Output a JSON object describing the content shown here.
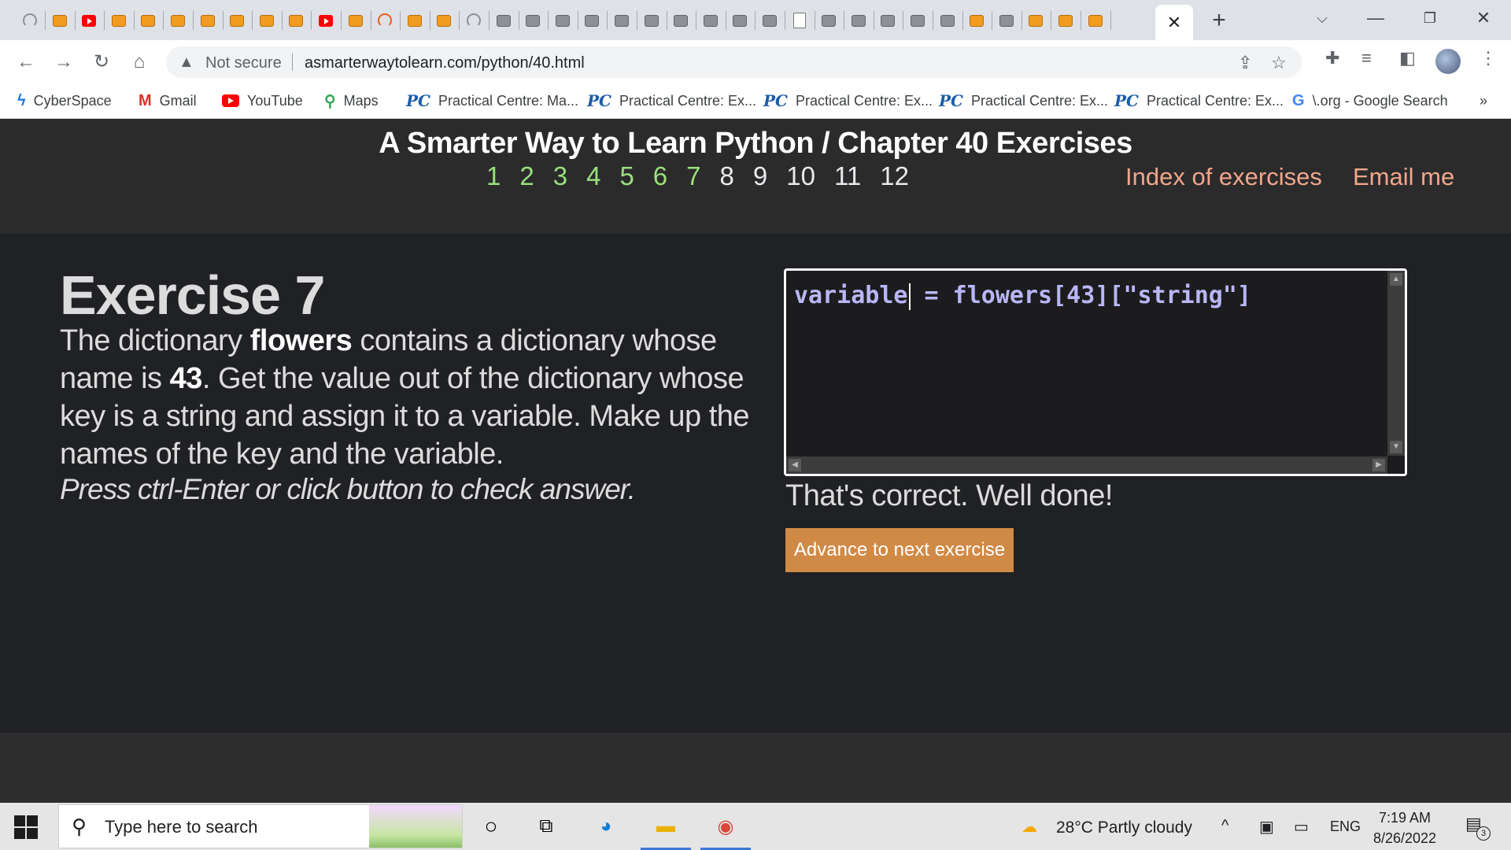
{
  "browser": {
    "tabs": [
      "load",
      "book",
      "yt",
      "book",
      "book",
      "book",
      "book",
      "book",
      "book",
      "book",
      "yt",
      "book",
      "load-o",
      "book",
      "book",
      "load",
      "book-gray",
      "book-gray",
      "book-gray",
      "book-gray",
      "book-gray",
      "book-gray",
      "book-gray",
      "book-gray",
      "book-gray",
      "book-gray",
      "doc",
      "book-gray",
      "book-gray",
      "book-gray",
      "book-gray",
      "book-gray",
      "book",
      "book-gray",
      "book",
      "book",
      "book"
    ],
    "active_tab_close": "✕",
    "new_tab": "+",
    "security_label": "Not secure",
    "url": "asmarterwaytolearn.com/python/40.html",
    "bookmarks": [
      {
        "icon": "ϟ",
        "kind": "cs",
        "label": "CyberSpace"
      },
      {
        "icon": "M",
        "kind": "gm",
        "label": "Gmail"
      },
      {
        "icon": "",
        "kind": "yt",
        "label": "YouTube"
      },
      {
        "icon": "⚲",
        "kind": "maps",
        "label": "Maps"
      },
      {
        "icon": "PC",
        "kind": "pc",
        "label": "Practical Centre: Ma..."
      },
      {
        "icon": "PC",
        "kind": "pc",
        "label": "Practical Centre: Ex..."
      },
      {
        "icon": "PC",
        "kind": "pc",
        "label": "Practical Centre: Ex..."
      },
      {
        "icon": "PC",
        "kind": "pc",
        "label": "Practical Centre: Ex..."
      },
      {
        "icon": "PC",
        "kind": "pc",
        "label": "Practical Centre: Ex..."
      },
      {
        "icon": "G",
        "kind": "g",
        "label": "\\.org - Google Search"
      }
    ],
    "bookmarks_overflow": "»"
  },
  "page": {
    "title": "A Smarter Way to Learn Python / Chapter 40 Exercises",
    "exercise_links": [
      {
        "label": "1",
        "state": "done"
      },
      {
        "label": "2",
        "state": "done"
      },
      {
        "label": "3",
        "state": "done"
      },
      {
        "label": "4",
        "state": "done"
      },
      {
        "label": "5",
        "state": "done"
      },
      {
        "label": "6",
        "state": "done"
      },
      {
        "label": "7",
        "state": "current"
      },
      {
        "label": "8",
        "state": "todo"
      },
      {
        "label": "9",
        "state": "todo"
      },
      {
        "label": "10",
        "state": "todo"
      },
      {
        "label": "11",
        "state": "todo"
      },
      {
        "label": "12",
        "state": "todo"
      }
    ],
    "index_link": "Index of exercises",
    "email_link": "Email me",
    "exercise": {
      "heading": "Exercise 7",
      "text_parts": [
        "The dictionary ",
        "flowers",
        " contains a dictionary whose name is ",
        "43",
        ". Get the value out of the dictionary whose key is a string and assign it to a variable. Make up the names of the key and the variable."
      ],
      "hint": "Press ctrl-Enter or click button to check answer."
    },
    "editor": {
      "code_before_caret": "variable",
      "code_after_caret": " = flowers[43][\"string\"]"
    },
    "feedback": "That's correct. Well done!",
    "advance_button": "Advance to next exercise"
  },
  "taskbar": {
    "search_placeholder": "Type here to search",
    "weather": "28°C  Partly cloudy",
    "language": "ENG",
    "time": "7:19 AM",
    "date": "8/26/2022",
    "notification_count": "3"
  },
  "colors": {
    "exercise_done": "#9be07c",
    "link_accent": "#f1a68a",
    "button": "#d08a46",
    "code": "#b9b6f7"
  }
}
